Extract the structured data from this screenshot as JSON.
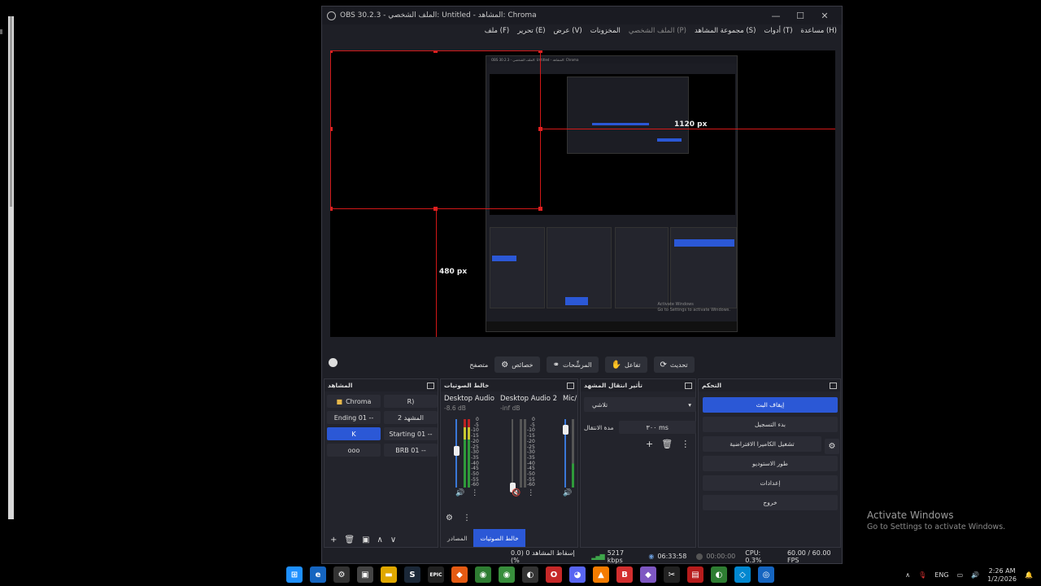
{
  "window": {
    "title": "OBS 30.2.3 - الملف الشخصي: Untitled - المشاهد: Chroma",
    "controls": [
      "—",
      "☐",
      "✕"
    ]
  },
  "menu": [
    {
      "label": "ملف (F)",
      "dim": false
    },
    {
      "label": "تحرير (E)",
      "dim": false
    },
    {
      "label": "عرض (V)",
      "dim": false
    },
    {
      "label": "المخزونات",
      "dim": false
    },
    {
      "label": "الملف الشخصي (P)",
      "dim": true
    },
    {
      "label": "مجموعة المشاهد (S)",
      "dim": false
    },
    {
      "label": "أدوات (T)",
      "dim": false
    },
    {
      "label": "مساعدة (H)",
      "dim": false
    }
  ],
  "preview": {
    "label_1120": "1120 px",
    "label_480": "480 px",
    "nested_title": "OBS 30.2.3 - الملف الشخصي: Untitled - المشاهد: Chroma",
    "nested_watermark_1": "Activate Windows",
    "nested_watermark_2": "Go to Settings to activate Windows."
  },
  "toolbar": {
    "label": "متصفح",
    "buttons": [
      {
        "label": "خصائص",
        "icon": "⚙"
      },
      {
        "label": "المرشِّحات",
        "icon": "⚭"
      },
      {
        "label": "تفاعل",
        "icon": "✋"
      },
      {
        "label": "تحديث",
        "icon": "⟳"
      }
    ]
  },
  "scenes": {
    "title": "المشاهد",
    "items": [
      {
        "label": "Chroma",
        "active": false,
        "icon": "folder"
      },
      {
        "label": "R)",
        "active": false
      },
      {
        "label": "Ending 01 --",
        "active": false
      },
      {
        "label": "المشهد 2",
        "active": false
      },
      {
        "label": "K",
        "active": true
      },
      {
        "label": "Starting 01 --",
        "active": false
      },
      {
        "label": "ooo",
        "active": false
      },
      {
        "label": "BRB 01 --",
        "active": false
      }
    ],
    "footer_icons": [
      "+",
      "🗑",
      "▣",
      "∧",
      "∨"
    ]
  },
  "mixer": {
    "title": "خالط الصوتيات",
    "channels": [
      {
        "name": "Desktop Audio",
        "db": "-8.6 dB"
      },
      {
        "name": "Desktop Audio 2",
        "db": "-inf dB"
      },
      {
        "name": "Mic/",
        "db": ""
      }
    ],
    "scale": [
      "0",
      "-5",
      "-10",
      "-15",
      "-20",
      "-25",
      "-30",
      "-35",
      "-40",
      "-45",
      "-50",
      "-55",
      "-60"
    ],
    "tabs": [
      {
        "label": "المصادر",
        "active": false
      },
      {
        "label": "خالط الصوتيات",
        "active": true
      }
    ]
  },
  "transitions": {
    "title": "تأثير انتقال المشهد",
    "selected": "تلاشي",
    "duration_label": "مدة الانتقال",
    "duration_value": "٣٠٠ ms"
  },
  "controls": {
    "title": "التحكم",
    "buttons": [
      {
        "label": "إيقاف البث",
        "primary": true
      },
      {
        "label": "بدء التسجيل",
        "primary": false
      },
      {
        "label": "تشغيل الكاميرا الافتراضية",
        "primary": false
      },
      {
        "label": "طور الاستوديو",
        "primary": false
      },
      {
        "label": "إعدادات",
        "primary": false
      },
      {
        "label": "خروج",
        "primary": false
      }
    ]
  },
  "status": {
    "dropped": "إسقاط المشاهد 0 (0.0 %)",
    "bitrate": "5217 kbps",
    "stream_time": "06:33:58",
    "record_time": "00:00:00",
    "cpu": "CPU: 0.3%",
    "fps": "60.00 / 60.00 FPS"
  },
  "watermark": {
    "line1": "Activate Windows",
    "line2": "Go to Settings to activate Windows."
  },
  "taskbar": {
    "icons": [
      {
        "name": "windows-start-icon",
        "glyph": "⊞",
        "color": "#1e90ff"
      },
      {
        "name": "edge-icon",
        "glyph": "e",
        "color": "#1565c0"
      },
      {
        "name": "settings-icon",
        "glyph": "⚙",
        "color": "#333"
      },
      {
        "name": "store-icon",
        "glyph": "▣",
        "color": "#444"
      },
      {
        "name": "file-explorer-icon",
        "glyph": "▬",
        "color": "#e0a800"
      },
      {
        "name": "steam-icon",
        "glyph": "S",
        "color": "#1b2838"
      },
      {
        "name": "epic-games-icon",
        "glyph": "EPIC",
        "color": "#222"
      },
      {
        "name": "app-orange-icon",
        "glyph": "◆",
        "color": "#e55b13"
      },
      {
        "name": "chrome-icon",
        "glyph": "◉",
        "color": "#2e7d32"
      },
      {
        "name": "chrome-alt-icon",
        "glyph": "◉",
        "color": "#388e3c"
      },
      {
        "name": "obs-icon",
        "glyph": "◐",
        "color": "#333"
      },
      {
        "name": "opera-icon",
        "glyph": "O",
        "color": "#c62828"
      },
      {
        "name": "discord-icon",
        "glyph": "◕",
        "color": "#5865f2"
      },
      {
        "name": "vlc-icon",
        "glyph": "▲",
        "color": "#f57c00"
      },
      {
        "name": "app-red-icon",
        "glyph": "B",
        "color": "#d32f2f"
      },
      {
        "name": "app-purple-icon",
        "glyph": "◆",
        "color": "#7e57c2"
      },
      {
        "name": "capcut-icon",
        "glyph": "✂",
        "color": "#222"
      },
      {
        "name": "app-red2-icon",
        "glyph": "▤",
        "color": "#b71c1c"
      },
      {
        "name": "app-green-icon",
        "glyph": "◐",
        "color": "#2e7d32"
      },
      {
        "name": "app-blue-icon",
        "glyph": "◇",
        "color": "#0288d1"
      },
      {
        "name": "app-blue2-icon",
        "glyph": "◎",
        "color": "#1565c0"
      }
    ],
    "lang": "ENG",
    "time": "2:26 AM",
    "date": "1/2/2026"
  }
}
